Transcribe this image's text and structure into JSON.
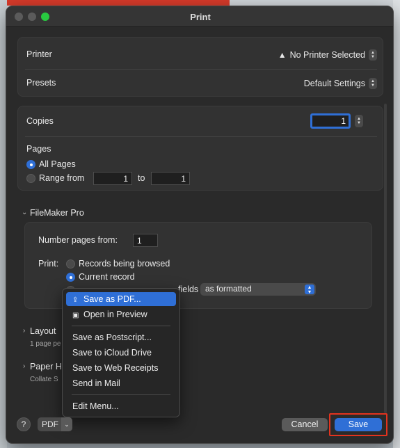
{
  "window": {
    "title": "Print"
  },
  "printer": {
    "label": "Printer",
    "value": "No Printer Selected",
    "warning_icon": "warning-triangle-icon"
  },
  "presets": {
    "label": "Presets",
    "value": "Default Settings"
  },
  "copies": {
    "label": "Copies",
    "value": "1"
  },
  "pages": {
    "label": "Pages",
    "all_label": "All Pages",
    "range_label": "Range from",
    "from": "1",
    "to_label": "to",
    "to": "1",
    "selected": "all"
  },
  "filemaker": {
    "title": "FileMaker Pro",
    "number_pages_label": "Number pages from:",
    "number_pages_value": "1",
    "print_label": "Print:",
    "options": [
      "Records being browsed",
      "Current record",
      "fields"
    ],
    "selected_option": 1,
    "format_value": "as formatted"
  },
  "layout": {
    "title": "Layout",
    "sub": "1 page pe"
  },
  "paper": {
    "title": "Paper H",
    "sub": "Collate S"
  },
  "menu": {
    "items": [
      "Save as PDF...",
      "Open in Preview",
      "Save as Postscript...",
      "Save to iCloud Drive",
      "Save to Web Receipts",
      "Send in Mail",
      "Edit Menu..."
    ],
    "highlighted": 0
  },
  "bottom": {
    "help": "?",
    "pdf_label": "PDF",
    "cancel_label": "Cancel",
    "save_label": "Save"
  },
  "colors": {
    "accent": "#2f6fd6",
    "highlight_box": "#e3331e"
  }
}
